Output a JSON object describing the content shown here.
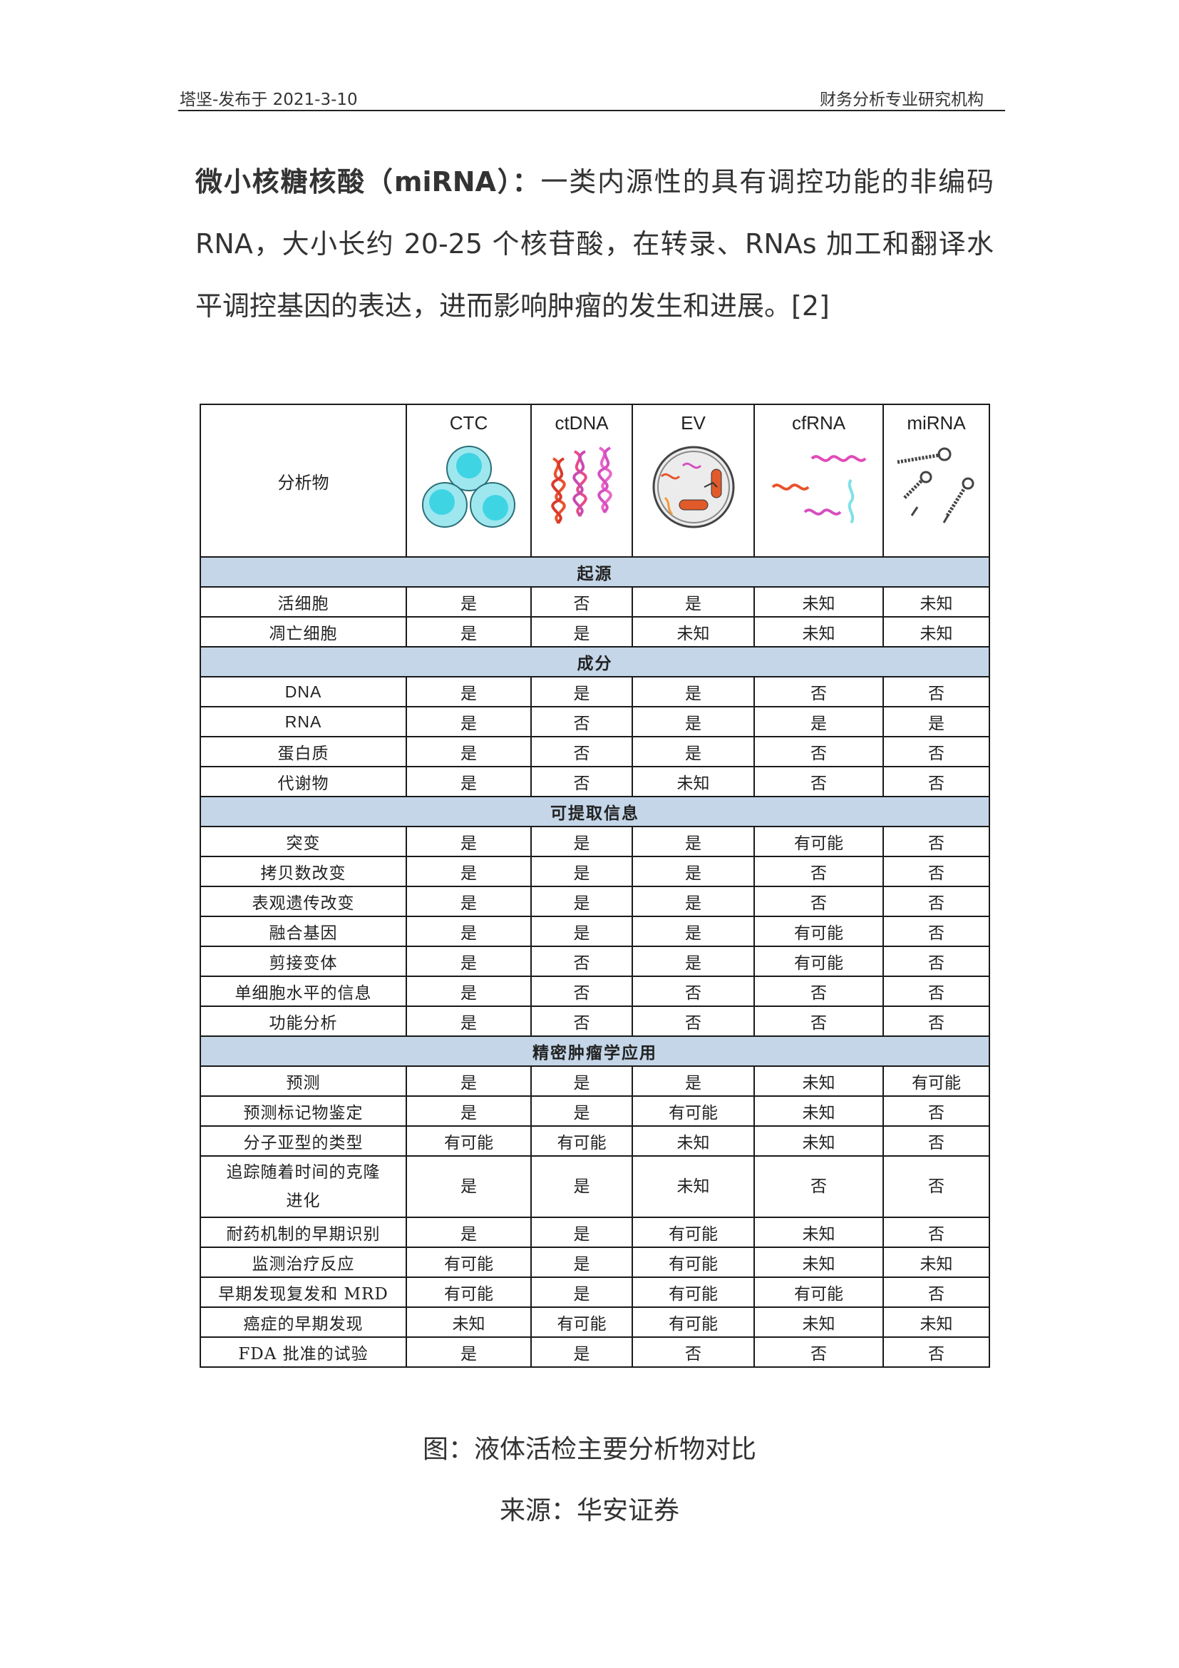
{
  "header": {
    "left": "塔坚-发布于 2021-3-10",
    "right": "财务分析专业研究机构"
  },
  "paragraph": {
    "term": "微小核糖核酸（miRNA）：",
    "text": "一类内源性的具有调控功能的非编码RNA，大小长约 20-25 个核苷酸，在转录、RNAs 加工和翻译水平调控基因的表达，进而影响肿瘤的发生和进展。[2]"
  },
  "table": {
    "analyte_label": "分析物",
    "columns": [
      "CTC",
      "ctDNA",
      "EV",
      "cfRNA",
      "miRNA"
    ],
    "column_icons": [
      "cells-icon",
      "dna-helix-icon",
      "vesicle-icon",
      "rna-strands-icon",
      "mirna-hairpin-icon"
    ],
    "sections": [
      {
        "title": "起源",
        "rows": [
          {
            "label": "活细胞",
            "values": [
              "是",
              "否",
              "是",
              "未知",
              "未知"
            ]
          },
          {
            "label": "凋亡细胞",
            "values": [
              "是",
              "是",
              "未知",
              "未知",
              "未知"
            ]
          }
        ]
      },
      {
        "title": "成分",
        "rows": [
          {
            "label": "DNA",
            "values": [
              "是",
              "是",
              "是",
              "否",
              "否"
            ]
          },
          {
            "label": "RNA",
            "values": [
              "是",
              "否",
              "是",
              "是",
              "是"
            ]
          },
          {
            "label": "蛋白质",
            "values": [
              "是",
              "否",
              "是",
              "否",
              "否"
            ]
          },
          {
            "label": "代谢物",
            "values": [
              "是",
              "否",
              "未知",
              "否",
              "否"
            ]
          }
        ]
      },
      {
        "title": "可提取信息",
        "rows": [
          {
            "label": "突变",
            "values": [
              "是",
              "是",
              "是",
              "有可能",
              "否"
            ]
          },
          {
            "label": "拷贝数改变",
            "values": [
              "是",
              "是",
              "是",
              "否",
              "否"
            ]
          },
          {
            "label": "表观遗传改变",
            "values": [
              "是",
              "是",
              "是",
              "否",
              "否"
            ]
          },
          {
            "label": "融合基因",
            "values": [
              "是",
              "是",
              "是",
              "有可能",
              "否"
            ]
          },
          {
            "label": "剪接变体",
            "values": [
              "是",
              "否",
              "是",
              "有可能",
              "否"
            ]
          },
          {
            "label": "单细胞水平的信息",
            "values": [
              "是",
              "否",
              "否",
              "否",
              "否"
            ]
          },
          {
            "label": "功能分析",
            "values": [
              "是",
              "否",
              "否",
              "否",
              "否"
            ]
          }
        ]
      },
      {
        "title": "精密肿瘤学应用",
        "rows": [
          {
            "label": "预测",
            "values": [
              "是",
              "是",
              "是",
              "未知",
              "有可能"
            ]
          },
          {
            "label": "预测标记物鉴定",
            "values": [
              "是",
              "是",
              "有可能",
              "未知",
              "否"
            ]
          },
          {
            "label": "分子亚型的类型",
            "values": [
              "有可能",
              "有可能",
              "未知",
              "未知",
              "否"
            ]
          },
          {
            "label": "追踪随着时间的克隆进化",
            "tall": true,
            "values": [
              "是",
              "是",
              "未知",
              "否",
              "否"
            ]
          },
          {
            "label": "耐药机制的早期识别",
            "values": [
              "是",
              "是",
              "有可能",
              "未知",
              "否"
            ]
          },
          {
            "label": "监测治疗反应",
            "values": [
              "有可能",
              "是",
              "有可能",
              "未知",
              "未知"
            ]
          },
          {
            "label": "早期发现复发和 MRD",
            "values": [
              "有可能",
              "是",
              "有可能",
              "有可能",
              "否"
            ]
          },
          {
            "label": "癌症的早期发现",
            "values": [
              "未知",
              "有可能",
              "有可能",
              "未知",
              "未知"
            ]
          },
          {
            "label": "FDA 批准的试验",
            "values": [
              "是",
              "是",
              "否",
              "否",
              "否"
            ]
          }
        ]
      }
    ]
  },
  "captions": {
    "figure": "图：液体活检主要分析物对比",
    "source": "来源：华安证券"
  }
}
